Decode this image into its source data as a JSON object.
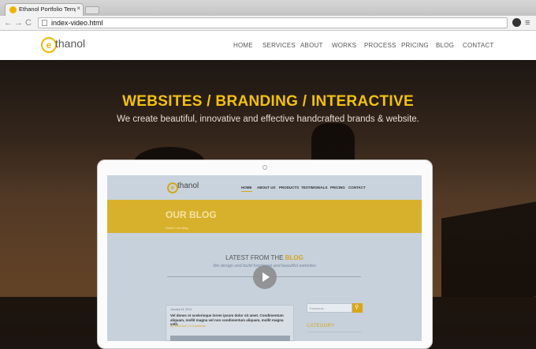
{
  "browser": {
    "tab_title": "Ethanol Portfolio Template",
    "tab_close": "×",
    "back": "←",
    "forward": "→",
    "refresh": "C",
    "url": "index-video.html",
    "menu_glyph": "≡"
  },
  "site": {
    "logo_text": "thanol",
    "logo_letter": "e",
    "nav": [
      "HOME",
      "SERVICES",
      "ABOUT",
      "WORKS",
      "PROCESS",
      "PRICING",
      "BLOG",
      "CONTACT"
    ]
  },
  "hero": {
    "headline": "WEBSITES / BRANDING / INTERACTIVE",
    "subline": "We create beautiful, innovative and effective handcrafted brands & website."
  },
  "preview": {
    "logo_text": "thanol",
    "logo_letter": "e",
    "nav": [
      "HOME",
      "ABOUT US",
      "PRODUCTS",
      "TESTIMONIALS",
      "PRICING",
      "CONTACT"
    ],
    "band_title": "OUR BLOG",
    "breadcrumb": "Home / our blog",
    "latest_prefix": "LATEST FROM THE ",
    "latest_highlight": "BLOG",
    "latest_sub": "We design and build functional and beautiful websites",
    "post_date": "January 24, 2014",
    "post_title": "Vel donec et scelerisque lorem ipsum dolor sit amet. Condimentum aliquam, mollit magna vel non condimentum aliquam, mollit magna velit.",
    "post_meta": "By John Doe  |  10 Comments",
    "search_placeholder": "Keywords...",
    "category": "CATEGORY"
  },
  "colors": {
    "accent": "#f2c20c",
    "preview_accent": "#d7a61a"
  }
}
